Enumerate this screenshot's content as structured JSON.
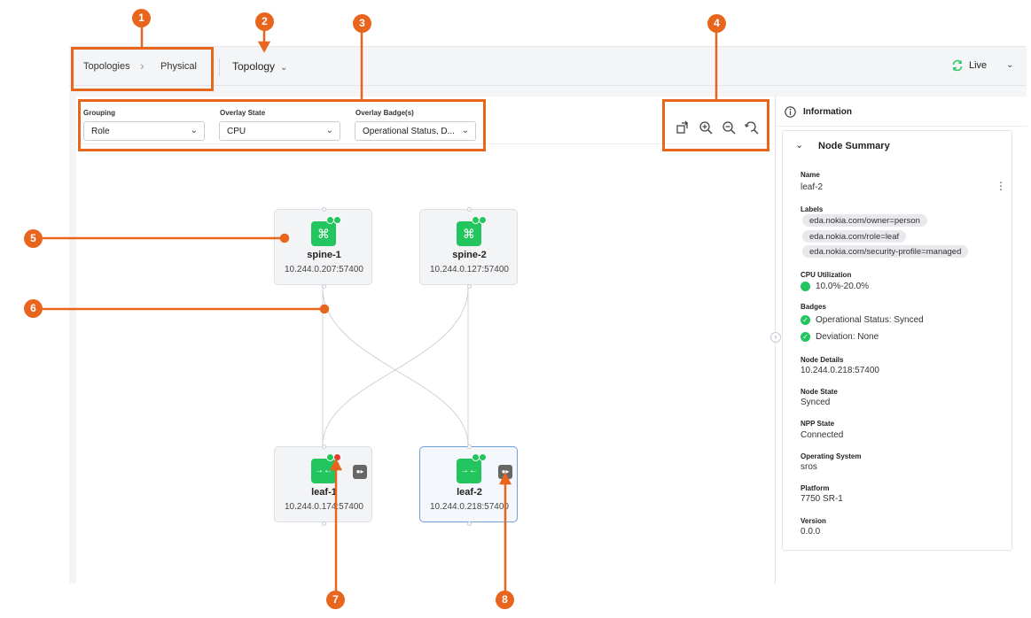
{
  "breadcrumb": {
    "root": "Topologies",
    "current": "Physical"
  },
  "topology_dropdown": {
    "label": "Topology"
  },
  "live": {
    "label": "Live"
  },
  "filters": {
    "grouping": {
      "label": "Grouping",
      "value": "Role"
    },
    "overlay_state": {
      "label": "Overlay State",
      "value": "CPU"
    },
    "overlay_badges": {
      "label": "Overlay Badge(s)",
      "value": "Operational Status, D..."
    }
  },
  "toolbar": {
    "icons": [
      "rotate-icon",
      "zoom-in-icon",
      "zoom-out-icon",
      "reset-zoom-icon"
    ]
  },
  "nodes": [
    {
      "name": "spine-1",
      "address": "10.244.0.207:57400"
    },
    {
      "name": "spine-2",
      "address": "10.244.0.127:57400"
    },
    {
      "name": "leaf-1",
      "address": "10.244.0.174:57400"
    },
    {
      "name": "leaf-2",
      "address": "10.244.0.218:57400"
    }
  ],
  "panel": {
    "title": "Information",
    "section": "Node Summary",
    "name_label": "Name",
    "name_value": "leaf-2",
    "labels_label": "Labels",
    "labels": [
      "eda.nokia.com/owner=person",
      "eda.nokia.com/role=leaf",
      "eda.nokia.com/security-profile=managed"
    ],
    "cpu_label": "CPU Utilization",
    "cpu_value": "10.0%-20.0%",
    "badges_label": "Badges",
    "badge_1": "Operational Status: Synced",
    "badge_2": "Deviation: None",
    "details_label": "Node Details",
    "details_value": "10.244.0.218:57400",
    "state_label": "Node State",
    "state_value": "Synced",
    "npp_label": "NPP State",
    "npp_value": "Connected",
    "os_label": "Operating System",
    "os_value": "sros",
    "platform_label": "Platform",
    "platform_value": "7750 SR-1",
    "version_label": "Version",
    "version_value": "0.0.0"
  },
  "callouts": [
    "1",
    "2",
    "3",
    "4",
    "5",
    "6",
    "7",
    "8"
  ],
  "colors": {
    "accent": "#e8651d",
    "node_green": "#22c55e",
    "alarm_red": "#e53935",
    "selected_border": "#6fa0e0"
  }
}
